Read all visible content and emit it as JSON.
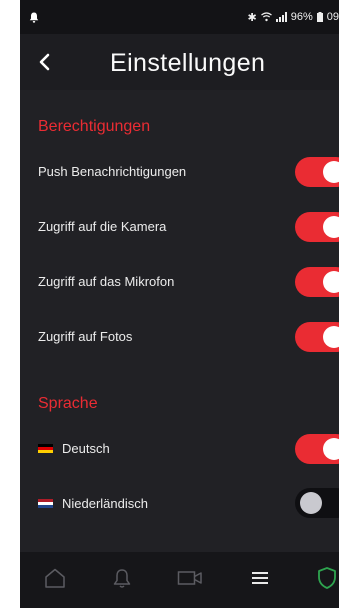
{
  "status_bar": {
    "right_text": "96%",
    "time_partial": "09",
    "icons": [
      "notification-bell-icon",
      "bluetooth-icon",
      "wifi-icon",
      "signal-icon",
      "battery-icon"
    ]
  },
  "header": {
    "back_icon": "chevron-left-icon",
    "title": "Einstellungen"
  },
  "sections": {
    "permissions": {
      "title": "Berechtigungen",
      "items": [
        {
          "label": "Push Benachrichtigungen",
          "enabled": true
        },
        {
          "label": "Zugriff auf die Kamera",
          "enabled": true
        },
        {
          "label": "Zugriff auf das Mikrofon",
          "enabled": true
        },
        {
          "label": "Zugriff auf Fotos",
          "enabled": true
        }
      ]
    },
    "language": {
      "title": "Sprache",
      "items": [
        {
          "label": "Deutsch",
          "flag": "german-flag-icon",
          "enabled": true
        },
        {
          "label": "Niederländisch",
          "flag": "dutch-flag-icon",
          "enabled": false
        }
      ]
    }
  },
  "bottom_nav": {
    "items": [
      {
        "icon": "home-icon",
        "active": false
      },
      {
        "icon": "bell-icon",
        "active": false
      },
      {
        "icon": "video-camera-icon",
        "active": false
      },
      {
        "icon": "menu-icon",
        "active": false
      },
      {
        "icon": "shield-icon",
        "active": true
      }
    ]
  },
  "colors": {
    "accent": "#ea2c33",
    "background": "#212125",
    "active_nav": "#2ea44f"
  }
}
